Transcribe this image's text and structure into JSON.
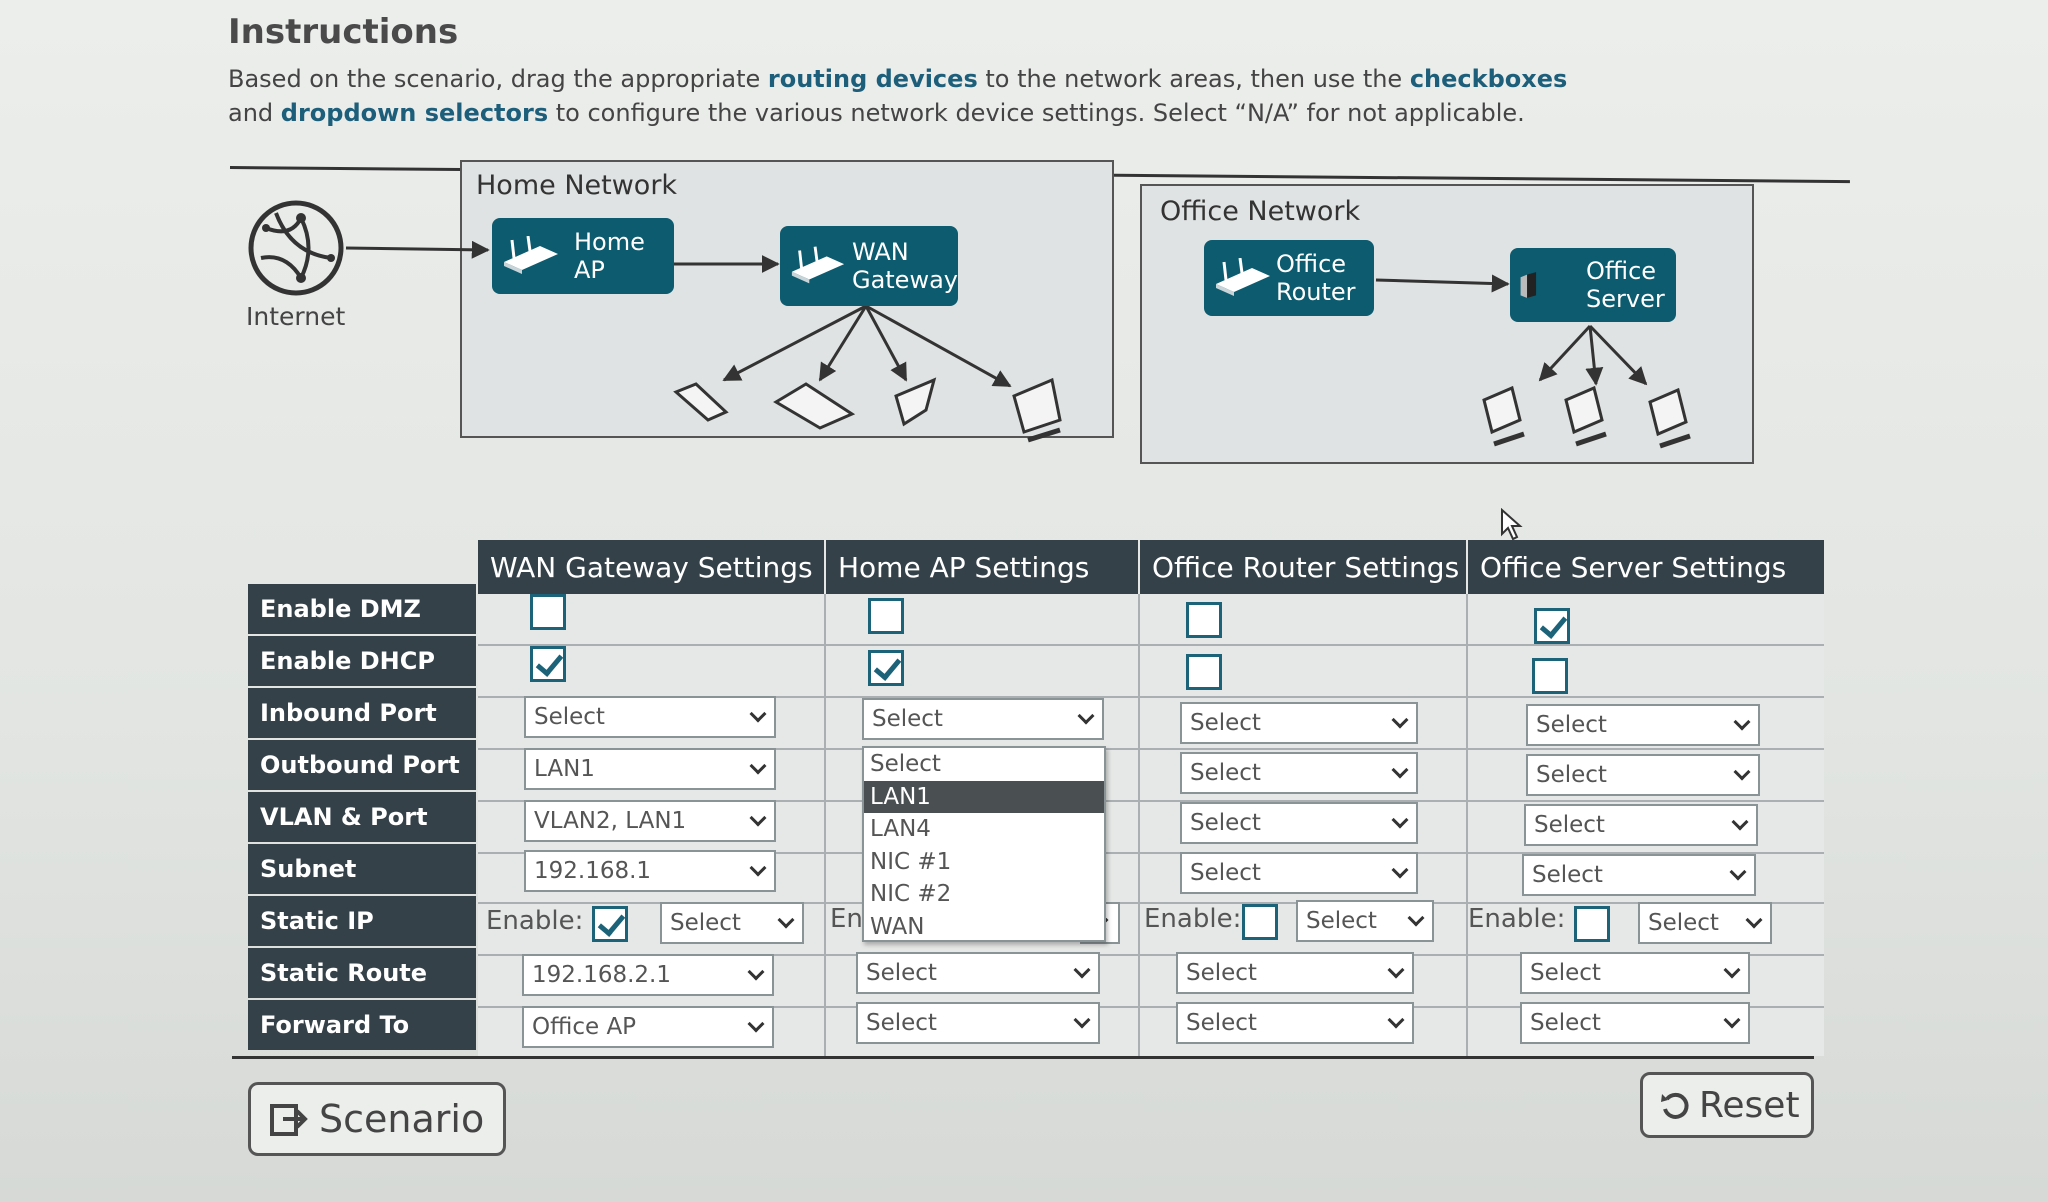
{
  "instructions": {
    "title": "Instructions",
    "text_1": "Based on the scenario, drag the appropriate ",
    "routing_devices": "routing devices",
    "text_2": " to the network areas, then use the ",
    "checkboxes": "checkboxes",
    "text_3": " and ",
    "dropdown_selectors": "dropdown selectors",
    "text_4": " to configure the various network device settings. Select “N/A” for not applicable."
  },
  "diagram": {
    "internet_label": "Internet",
    "home_network_title": "Home Network",
    "office_network_title": "Office Network",
    "devices": {
      "home_ap": "Home\nAP",
      "wan_gateway": "WAN\nGateway",
      "office_router": "Office\nRouter",
      "office_server": "Office\nServer"
    }
  },
  "table": {
    "columns": [
      "WAN Gateway Settings",
      "Home AP Settings",
      "Office Router Settings",
      "Office Server Settings"
    ],
    "rows": [
      "Enable DMZ",
      "Enable DHCP",
      "Inbound Port",
      "Outbound Port",
      "VLAN & Port",
      "Subnet",
      "Static IP",
      "Static Route",
      "Forward To"
    ],
    "enable_label": "Enable:",
    "enable_label_cut": "En",
    "wan_gateway": {
      "enable_dmz": false,
      "enable_dhcp": true,
      "inbound_port": "Select",
      "outbound_port": "LAN1",
      "vlan_port": "VLAN2, LAN1",
      "subnet": "192.168.1",
      "static_ip_enabled": true,
      "static_ip": "Select",
      "static_route": "192.168.2.1",
      "forward_to": "Office AP"
    },
    "home_ap": {
      "enable_dmz": false,
      "enable_dhcp": true,
      "inbound_port": "Select",
      "static_route": "Select",
      "forward_to": "Select"
    },
    "office_router": {
      "enable_dmz": false,
      "enable_dhcp": false,
      "inbound_port": "Select",
      "outbound_port": "Select",
      "vlan_port": "Select",
      "subnet": "Select",
      "static_ip_enabled": false,
      "static_ip": "Select",
      "static_route": "Select",
      "forward_to": "Select"
    },
    "office_server": {
      "enable_dmz": true,
      "enable_dhcp": false,
      "inbound_port": "Select",
      "outbound_port": "Select",
      "vlan_port": "Select",
      "subnet": "Select",
      "static_ip_enabled": false,
      "static_ip": "Select",
      "static_route": "Select",
      "forward_to": "Select"
    }
  },
  "open_dropdown": {
    "options": [
      "Select",
      "LAN1",
      "LAN4",
      "NIC #1",
      "NIC #2",
      "WAN"
    ],
    "highlighted": "LAN1"
  },
  "buttons": {
    "scenario": "Scenario",
    "reset": "Reset"
  },
  "colors": {
    "device_teal": "#0c5b6f",
    "header_slate": "#354149",
    "link_blue": "#1d5f7a",
    "check_teal": "#1c6278"
  }
}
